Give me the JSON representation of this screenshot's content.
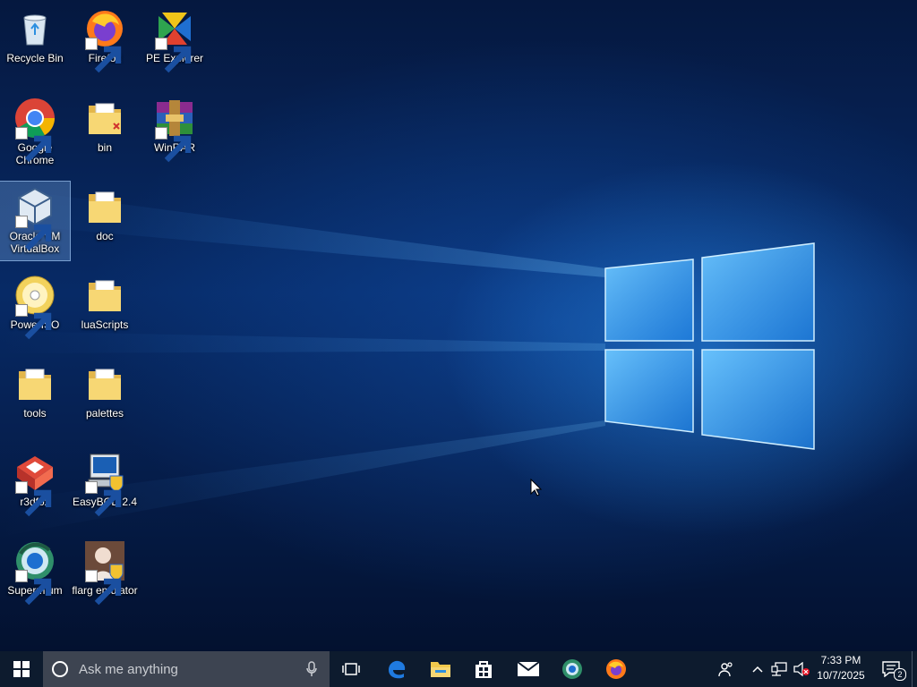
{
  "desktop": {
    "icons": [
      {
        "label": "Recycle Bin",
        "icon": "recycle-bin-icon"
      },
      {
        "label": "Firefox",
        "icon": "firefox-icon"
      },
      {
        "label": "PE Explorer",
        "icon": "pe-explorer-icon"
      },
      {
        "label": "Google Chrome",
        "icon": "chrome-icon"
      },
      {
        "label": "bin",
        "icon": "folder-icon"
      },
      {
        "label": "WinRAR",
        "icon": "winrar-icon"
      },
      {
        "label": "Oracle VM VirtualBox",
        "icon": "virtualbox-icon",
        "selected": true
      },
      {
        "label": "doc",
        "icon": "folder-icon"
      },
      {
        "label": "PowerISO",
        "icon": "poweriso-icon"
      },
      {
        "label": "luaScripts",
        "icon": "folder-icon"
      },
      {
        "label": "tools",
        "icon": "folder-icon"
      },
      {
        "label": "palettes",
        "icon": "folder-icon"
      },
      {
        "label": "r3dfox",
        "icon": "r3dfox-icon"
      },
      {
        "label": "EasyBCD 2.4",
        "icon": "easybcd-icon"
      },
      {
        "label": "Supermium",
        "icon": "supermium-icon"
      },
      {
        "label": "flarg emulator",
        "icon": "flarg-emulator-icon"
      }
    ]
  },
  "taskbar": {
    "search_placeholder": "Ask me anything",
    "pinned": [
      "task-view-icon",
      "edge-icon",
      "file-explorer-icon",
      "store-icon",
      "mail-icon",
      "supermium-icon",
      "firefox-icon"
    ],
    "clock": {
      "time": "7:33 PM",
      "date": "10/7/2025"
    },
    "notification_count": "2",
    "colors": {
      "background": "#0d1b2e",
      "search_box": "#3d4451"
    }
  }
}
